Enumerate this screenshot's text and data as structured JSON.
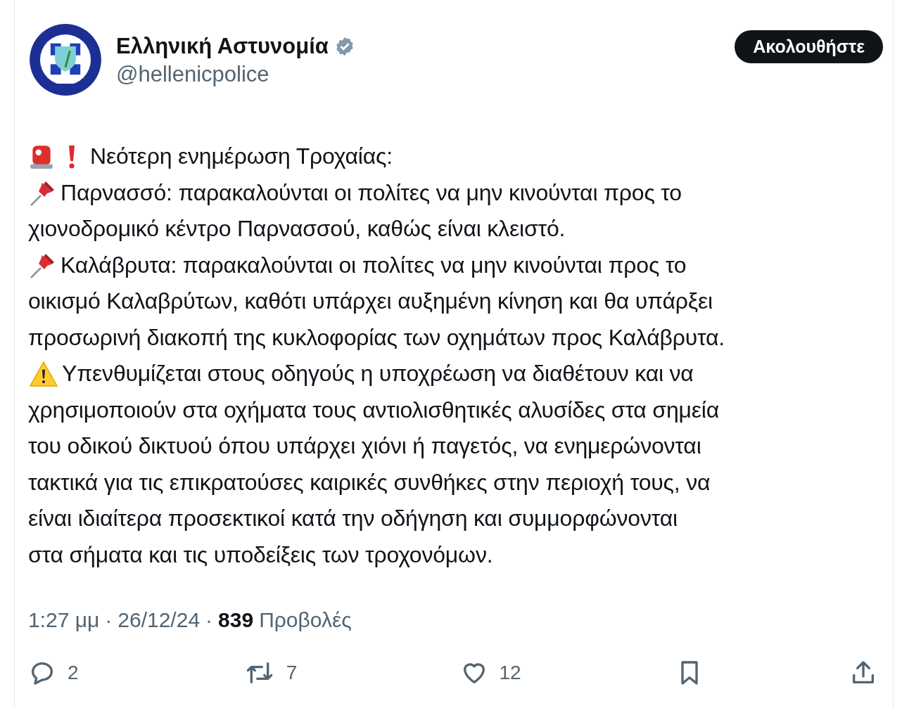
{
  "author": {
    "name": "Ελληνική Αστυνομία",
    "verified": true,
    "handle": "@hellenicpolice"
  },
  "follow_button": "Ακολουθήστε",
  "paragraphs": [
    {
      "icons": [
        {
          "kind": "siren"
        },
        {
          "kind": "exclamation"
        }
      ],
      "lines": [
        "Νεότερη ενημέρωση Τροχαίας:"
      ]
    },
    {
      "icons": [
        {
          "kind": "pushpin"
        }
      ],
      "lines": [
        "Παρνασσό: παρακαλούνται οι πολίτες να μην κινούνται προς το",
        "χιονοδρομικό κέντρο Παρνασσού, καθώς είναι κλειστό."
      ]
    },
    {
      "icons": [
        {
          "kind": "pushpin"
        }
      ],
      "lines": [
        "Καλάβρυτα: παρακαλούνται οι πολίτες να μην κινούνται προς το",
        "οικισμό Καλαβρύτων, καθότι υπάρχει αυξημένη κίνηση και θα υπάρξει",
        "προσωρινή διακοπή της κυκλοφορίας των οχημάτων προς Καλάβρυτα."
      ]
    },
    {
      "icons": [
        {
          "kind": "warning"
        }
      ],
      "lines": [
        "Υπενθυμίζεται στους οδηγούς η υποχρέωση να διαθέτουν και να",
        "χρησιμοποιούν στα οχήματα τους αντιολισθητικές αλυσίδες στα σημεία",
        "του οδικού δικτυού όπου υπάρχει χιόνι ή παγετός, να ενημερώνονται",
        "τακτικά για τις επικρατούσες καιρικές συνθήκες στην περιοχή τους, να",
        "είναι ιδιαίτερα προσεκτικοί κατά την οδήγηση και συμμορφώνονται",
        "στα σήματα και τις υποδείξεις των τροχονόμων."
      ]
    }
  ],
  "meta": [
    {
      "kind": "plain",
      "text": "1:27 μμ"
    },
    {
      "kind": "plain",
      "text": "·"
    },
    {
      "kind": "plain",
      "text": "26/12/24"
    },
    {
      "kind": "plain",
      "text": "·"
    },
    {
      "kind": "strong",
      "text": "839"
    },
    {
      "kind": "plain",
      "text": "Προβολές"
    }
  ],
  "actions": [
    {
      "kind": "reply",
      "count": "2"
    },
    {
      "kind": "repost",
      "count": "7"
    },
    {
      "kind": "like",
      "count": "12"
    },
    {
      "kind": "bookmark"
    },
    {
      "kind": "share"
    }
  ]
}
